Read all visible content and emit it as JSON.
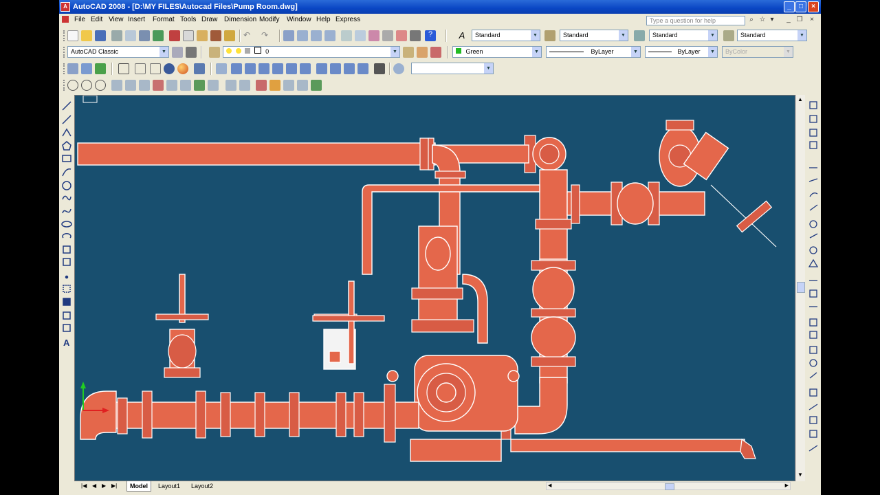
{
  "window": {
    "title": "AutoCAD 2008 - [D:\\MY FILES\\Autocad Files\\Pump Room.dwg]",
    "buttons": [
      "minimize",
      "maximize",
      "close"
    ]
  },
  "menu": {
    "items": [
      "File",
      "Edit",
      "View",
      "Insert",
      "Format",
      "Tools",
      "Draw",
      "Dimension",
      "Modify",
      "Window",
      "Help",
      "Express"
    ],
    "help_placeholder": "Type a question for help"
  },
  "toolbar1": {
    "text_style": "Standard",
    "dim_style": "Standard",
    "table_style": "Standard",
    "mleader_style": "Standard"
  },
  "toolbar2": {
    "workspace": "AutoCAD Classic",
    "layer": "0",
    "color": "Green",
    "linetype": "ByLayer",
    "lineweight": "ByLayer",
    "plotstyle": "ByColor"
  },
  "toolbar3": {
    "view_combo": ""
  },
  "layout_tabs": [
    "Model",
    "Layout1",
    "Layout2"
  ],
  "active_tab": "Model",
  "colors": {
    "canvas": "#184f6f",
    "pipe": "#e4674b",
    "title_bar": "#0a46c4",
    "ucs_y": "#22cc22",
    "ucs_x": "#e02020"
  },
  "drawing": {
    "description_icon": "pump-room-piping-drawing"
  }
}
